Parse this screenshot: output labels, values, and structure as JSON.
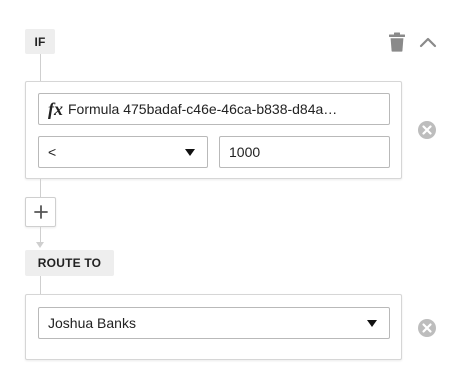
{
  "condition": {
    "badge": "IF",
    "formula": "Formula 475badaf-c46e-46ca-b838-d84a…",
    "fx_symbol": "fx",
    "operator": "<",
    "value": "1000"
  },
  "actions": {
    "delete_icon": "trash-icon",
    "collapse_icon": "chevron-up-icon",
    "remove_icon": "close-circle-icon",
    "add_icon": "plus-icon"
  },
  "route": {
    "badge": "ROUTE TO",
    "assignee": "Joshua Banks"
  },
  "colors": {
    "badge_bg": "#eeeeee",
    "icon_gray": "#8a8a8a",
    "remove_gray": "#bdbdbd",
    "connector": "#cfcfcf"
  }
}
